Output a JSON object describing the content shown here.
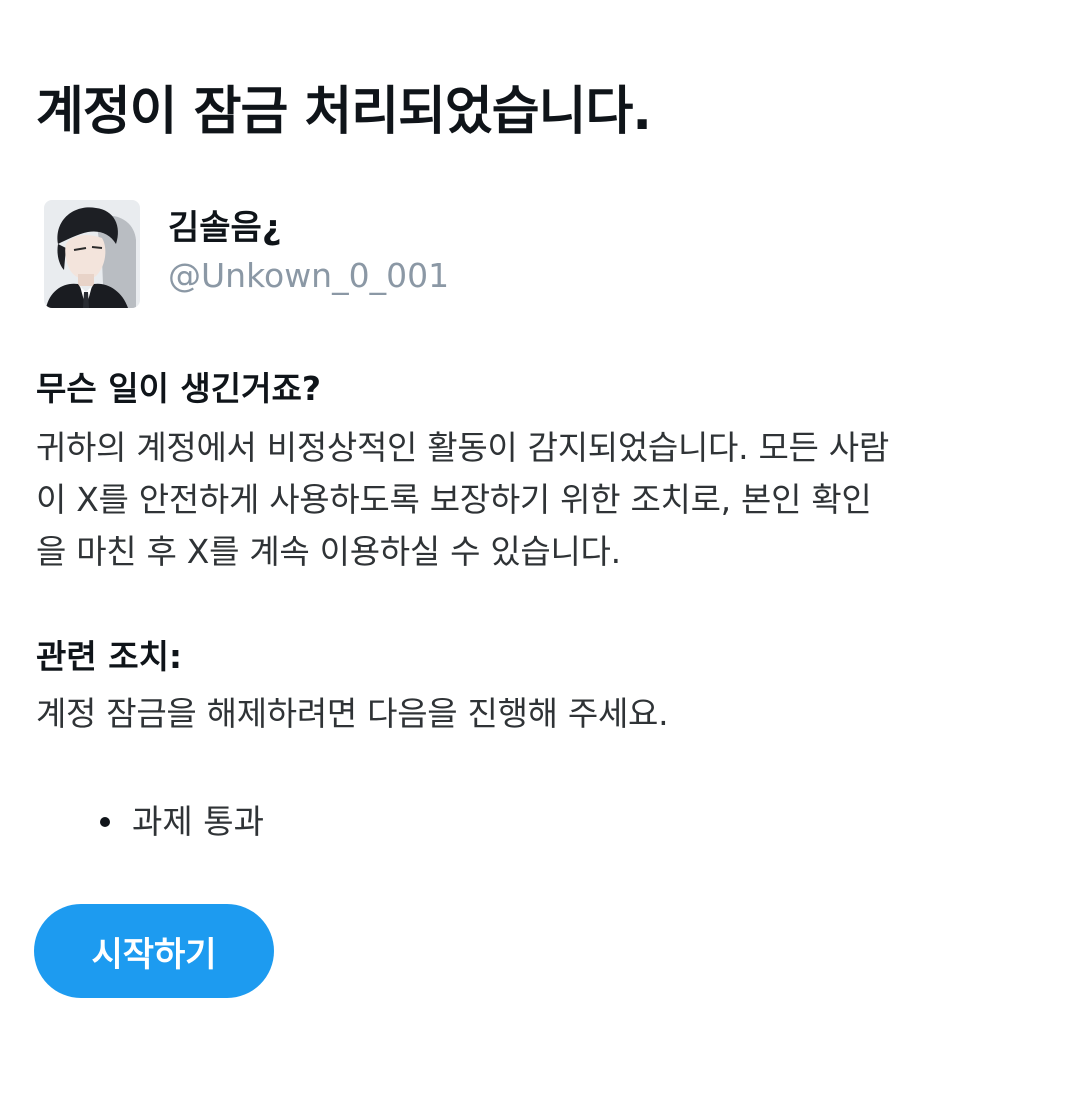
{
  "page": {
    "title": "계정이 잠금 처리되었습니다."
  },
  "profile": {
    "display_name": "김솔음¿",
    "handle": "@Unkown_0_001",
    "avatar_icon": "user-avatar-illustration"
  },
  "what_happened": {
    "heading": "무슨 일이 생긴거죠?",
    "body_lines": [
      "귀하의 계정에서 비정상적인 활동이 감지되었습니다. 모든 사람",
      "이 X를 안전하게 사용하도록 보장하기 위한 조치로, 본인 확인",
      "을 마친 후 X를 계속 이용하실 수 있습니다."
    ]
  },
  "related_action": {
    "heading": "관련 조치:",
    "body": "계정 잠금을 해제하려면 다음을 진행해 주세요.",
    "tasks": [
      "과제 통과"
    ]
  },
  "start_button": {
    "label": "시작하기",
    "color": "#1d9bf0"
  },
  "colors": {
    "text_primary": "#0f1419",
    "text_body": "#2f3336",
    "text_secondary": "#8b98a5",
    "accent": "#1d9bf0"
  }
}
